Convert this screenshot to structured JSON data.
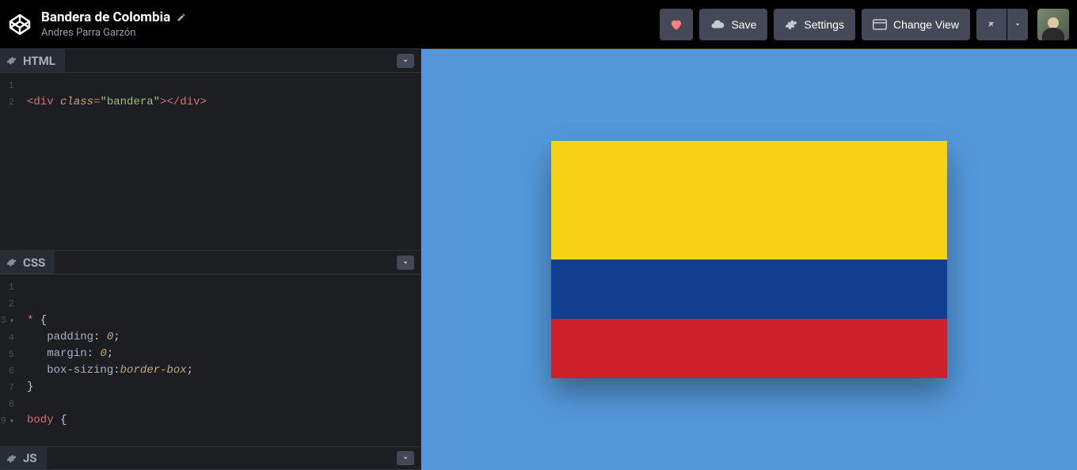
{
  "header": {
    "pen_title": "Bandera de Colombia",
    "author": "Andres Parra Garzón",
    "save_label": "Save",
    "settings_label": "Settings",
    "change_view_label": "Change View"
  },
  "panels": {
    "html": {
      "title": "HTML"
    },
    "css": {
      "title": "CSS"
    },
    "js": {
      "title": "JS"
    }
  },
  "code": {
    "html_lines": [
      "1",
      "2"
    ],
    "html_line2_tag_open_bracket": "<",
    "html_line2_tag_name": "div",
    "html_line2_attr": "class",
    "html_line2_eq": "=",
    "html_line2_str": "\"bandera\"",
    "html_line2_close": ">",
    "html_line2_endtag": "</",
    "html_line2_endname": "div",
    "html_line2_endclose": ">",
    "css_lines": [
      "1",
      "2",
      "3",
      "4",
      "5",
      "6",
      "7",
      "8",
      "9"
    ],
    "css_l3_sel": "*",
    "css_l3_brace": " {",
    "css_l4_prop": "padding",
    "css_l4_colon": ": ",
    "css_l4_val": "0",
    "css_l4_semi": ";",
    "css_l5_prop": "margin",
    "css_l5_colon": ": ",
    "css_l5_val": "0",
    "css_l5_semi": ";",
    "css_l6_prop": "box-sizing",
    "css_l6_colon": ":",
    "css_l6_val": "border-box",
    "css_l6_semi": ";",
    "css_l7_brace": "}",
    "css_l9_sel": "body",
    "css_l9_brace": " {"
  },
  "preview": {
    "bg": "#5498da",
    "flag_yellow": "#f7d116",
    "flag_blue": "#113e8e",
    "flag_red": "#cd202b"
  }
}
